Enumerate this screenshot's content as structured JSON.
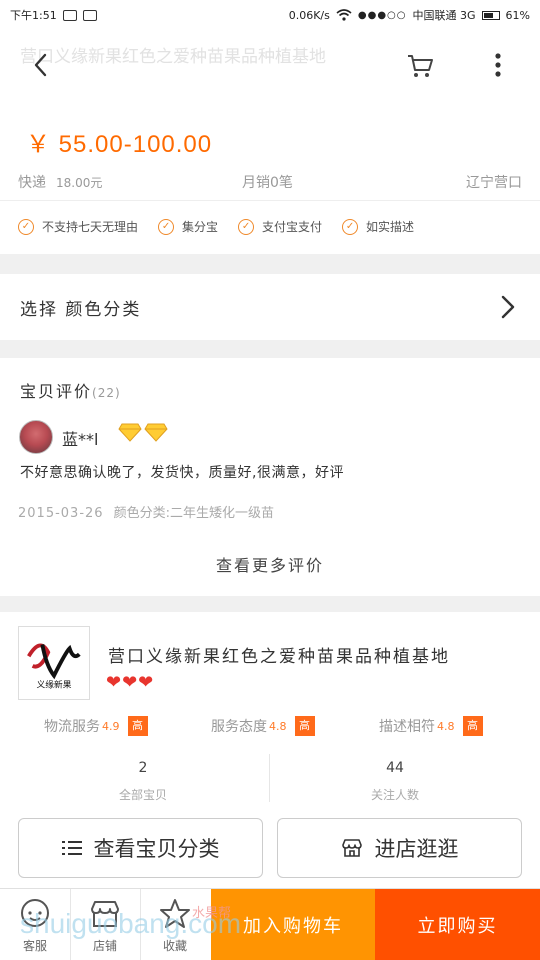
{
  "status_bar": {
    "time": "下午1:51",
    "net_speed": "0.06K/s",
    "carrier": "中国联通 3G",
    "battery": "61%"
  },
  "header": {
    "ghost_title": "营口义缘新果红色之爱种苗果品种植基地"
  },
  "product": {
    "price": "￥ 55.00-100.00",
    "shipping_label": "快递",
    "shipping_fee": "18.00元",
    "monthly_sales": "月销0笔",
    "location": "辽宁营口",
    "guarantees": [
      "不支持七天无理由",
      "集分宝",
      "支付宝支付",
      "如实描述"
    ]
  },
  "sku": {
    "label": "选择 颜色分类"
  },
  "reviews": {
    "title": "宝贝评价",
    "count": "(22)",
    "user": "蓝**l",
    "text": "不好意思确认晚了，发货快，质量好,很满意，好评",
    "date": "2015-03-26",
    "spec": "颜色分类:二年生矮化一级苗",
    "more_label": "查看更多评价"
  },
  "shop": {
    "logo_text": "义缘新果",
    "name": "营口义缘新果红色之爱种苗果品种植基地",
    "hearts": "❤❤❤",
    "scores": [
      {
        "label": "物流服务",
        "value": "4.9",
        "tag": "高"
      },
      {
        "label": "服务态度",
        "value": "4.8",
        "tag": "高"
      },
      {
        "label": "描述相符",
        "value": "4.8",
        "tag": "高"
      }
    ],
    "total_items": "2",
    "total_items_label": "全部宝贝",
    "followers": "44",
    "followers_label": "关注人数",
    "category_button": "查看宝贝分类",
    "store_button": "进店逛逛"
  },
  "bottom_bar": {
    "service": "客服",
    "store": "店铺",
    "favorite": "收藏",
    "add_to_cart": "加入购物车",
    "buy_now": "立即购买"
  },
  "watermark": {
    "text": "shuiguobang.com",
    "sub": "水果帮"
  },
  "colors": {
    "accent": "#ff6a00",
    "add_to_cart_bg": "#ff9402",
    "buy_now_bg": "#ff5000",
    "check": "#f08a2c",
    "hearts": "#e8352e"
  }
}
